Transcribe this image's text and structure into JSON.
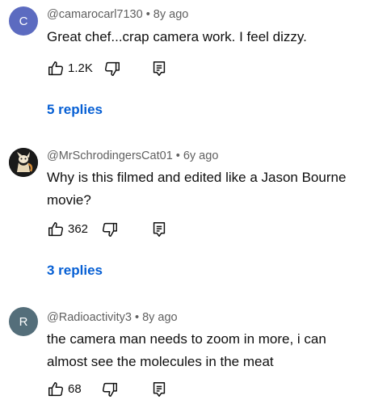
{
  "comments": [
    {
      "avatar_letter": "C",
      "avatar_color": "#5c6bc0",
      "username": "@camarocarl7130",
      "time": "8y ago",
      "text": "Great chef...crap camera work. I feel dizzy.",
      "likes": "1.2K",
      "replies": "5 replies"
    },
    {
      "avatar_icon": "cartoon-avatar-image",
      "avatar_color": "#1a1a1a",
      "username": "@MrSchrodingersCat01",
      "time": "6y ago",
      "text": "Why is this filmed and edited like a Jason Bourne movie?",
      "likes": "362",
      "replies": "3 replies"
    },
    {
      "avatar_letter": "R",
      "avatar_color": "#546e7a",
      "username": "@Radioactivity3",
      "time": "8y ago",
      "text": "the camera man needs to zoom in more, i can almost see the molecules in the meat",
      "likes": "68"
    }
  ],
  "separator": "•",
  "link_color": "#065fd4"
}
